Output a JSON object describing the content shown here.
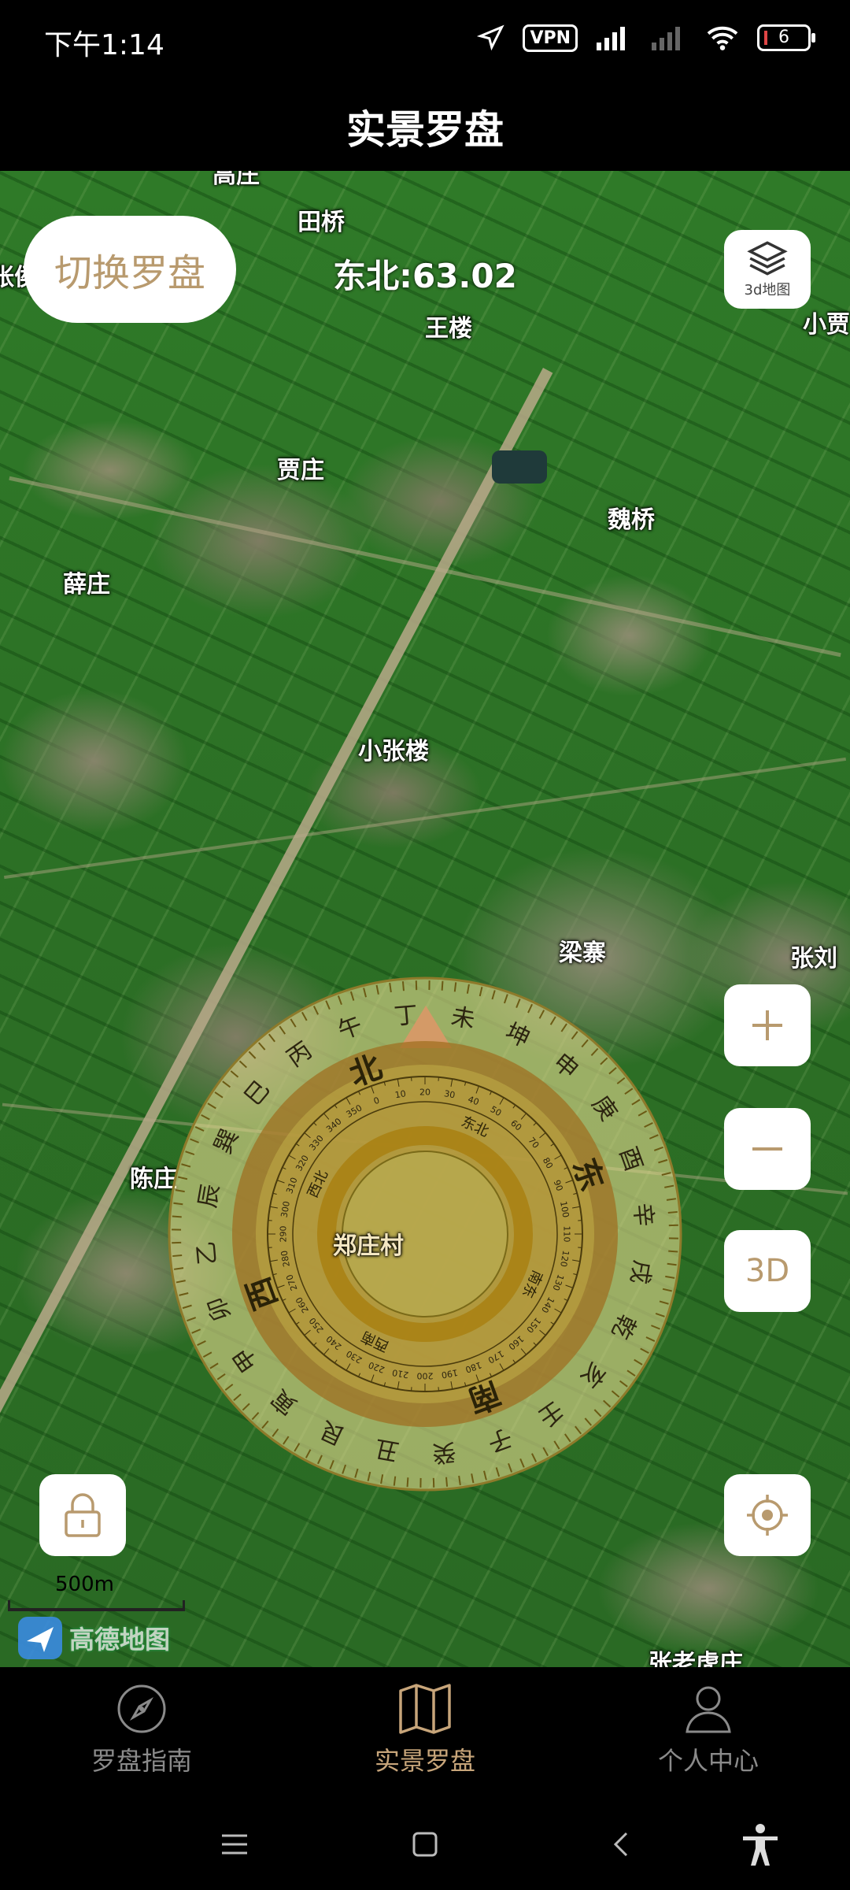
{
  "status_bar": {
    "time": "下午1:14",
    "vpn": "VPN",
    "battery": "6"
  },
  "header": {
    "title": "实景罗盘"
  },
  "map": {
    "heading_readout": "东北:63.02",
    "switch_compass_label": "切换罗盘",
    "layer_button_label": "3d地图",
    "three_d_label": "3D",
    "scale_label": "500m",
    "provider_label": "高德地图",
    "current_location_label": "郑庄村",
    "places": [
      {
        "name": "田桥"
      },
      {
        "name": "王楼"
      },
      {
        "name": "小贾"
      },
      {
        "name": "贾庄"
      },
      {
        "name": "魏桥"
      },
      {
        "name": "薛庄"
      },
      {
        "name": "小张楼"
      },
      {
        "name": "梁寨"
      },
      {
        "name": "张刘"
      },
      {
        "name": "陈庄"
      },
      {
        "name": "张老虎庄"
      },
      {
        "name": "张侯"
      },
      {
        "name": "高庄"
      }
    ]
  },
  "compass": {
    "outer_ring": [
      "午",
      "丁",
      "未",
      "坤",
      "申",
      "庚",
      "酉",
      "辛",
      "戌",
      "乾",
      "亥",
      "壬",
      "子",
      "癸",
      "丑",
      "艮",
      "寅",
      "甲",
      "卯",
      "乙",
      "辰",
      "巽",
      "巳",
      "丙"
    ],
    "direction_labels": {
      "east": "东",
      "south": "南",
      "west": "西",
      "north": "北"
    },
    "secondary_labels": {
      "northeast": "东北",
      "southeast": "南东",
      "southwest": "西南",
      "northwest": "西北"
    }
  },
  "bottom_nav": {
    "items": [
      {
        "label": "罗盘指南",
        "icon": "compass-icon",
        "active": false
      },
      {
        "label": "实景罗盘",
        "icon": "map-icon",
        "active": true
      },
      {
        "label": "个人中心",
        "icon": "person-icon",
        "active": false
      }
    ]
  },
  "colors": {
    "accent": "#b89a6e",
    "nav_active": "#c7a57a",
    "nav_inactive": "#8a8a8a",
    "pointer": "#c0392b"
  }
}
